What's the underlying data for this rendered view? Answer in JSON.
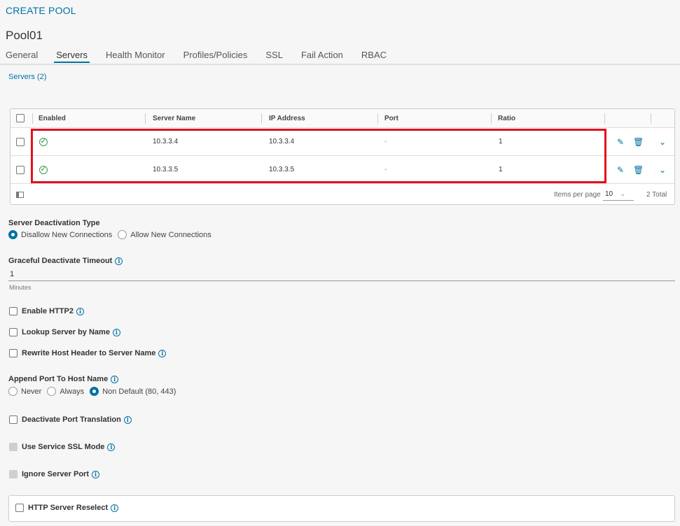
{
  "header": {
    "title": "CREATE POOL",
    "pool_name": "Pool01",
    "tabs": [
      {
        "label": "General"
      },
      {
        "label": "Servers"
      },
      {
        "label": "Health Monitor"
      },
      {
        "label": "Profiles/Policies"
      },
      {
        "label": "SSL"
      },
      {
        "label": "Fail Action"
      },
      {
        "label": "RBAC"
      }
    ],
    "active_tab": "Servers"
  },
  "servers": {
    "section_label": "Servers (2)",
    "columns": [
      "Enabled",
      "Server Name",
      "IP Address",
      "Port",
      "Ratio"
    ],
    "rows": [
      {
        "enabled_icon": "check-circle-icon",
        "server_name": "10.3.3.4",
        "ip_address": "10.3.3.4",
        "port": "-",
        "ratio": "1"
      },
      {
        "enabled_icon": "check-circle-icon",
        "server_name": "10.3.3.5",
        "ip_address": "10.3.3.5",
        "port": "-",
        "ratio": "1"
      }
    ],
    "footer": {
      "items_per_page_label": "Items per page",
      "items_per_page_value": "10",
      "total": "2 Total"
    }
  },
  "deactivation": {
    "label": "Server Deactivation Type",
    "options": [
      "Disallow New Connections",
      "Allow New Connections"
    ],
    "selected": "Disallow New Connections"
  },
  "timeout": {
    "label": "Graceful Deactivate Timeout",
    "value": "1",
    "unit": "Minutes"
  },
  "checkboxes": {
    "enable_http2": "Enable HTTP2",
    "lookup_server": "Lookup Server by Name",
    "rewrite_host": "Rewrite Host Header to Server Name"
  },
  "append_port": {
    "label": "Append Port To Host Name",
    "options": [
      "Never",
      "Always",
      "Non Default (80, 443)"
    ],
    "selected": "Non Default (80, 443)"
  },
  "more_checkboxes": {
    "deactivate_port_translation": "Deactivate Port Translation",
    "use_service_ssl": "Use Service SSL Mode",
    "ignore_server_port": "Ignore Server Port",
    "http_server_reselect": "HTTP Server Reselect"
  },
  "colors": {
    "accent": "#0072a3",
    "highlight": "#e0121f",
    "enabled": "#3c9a4a"
  }
}
